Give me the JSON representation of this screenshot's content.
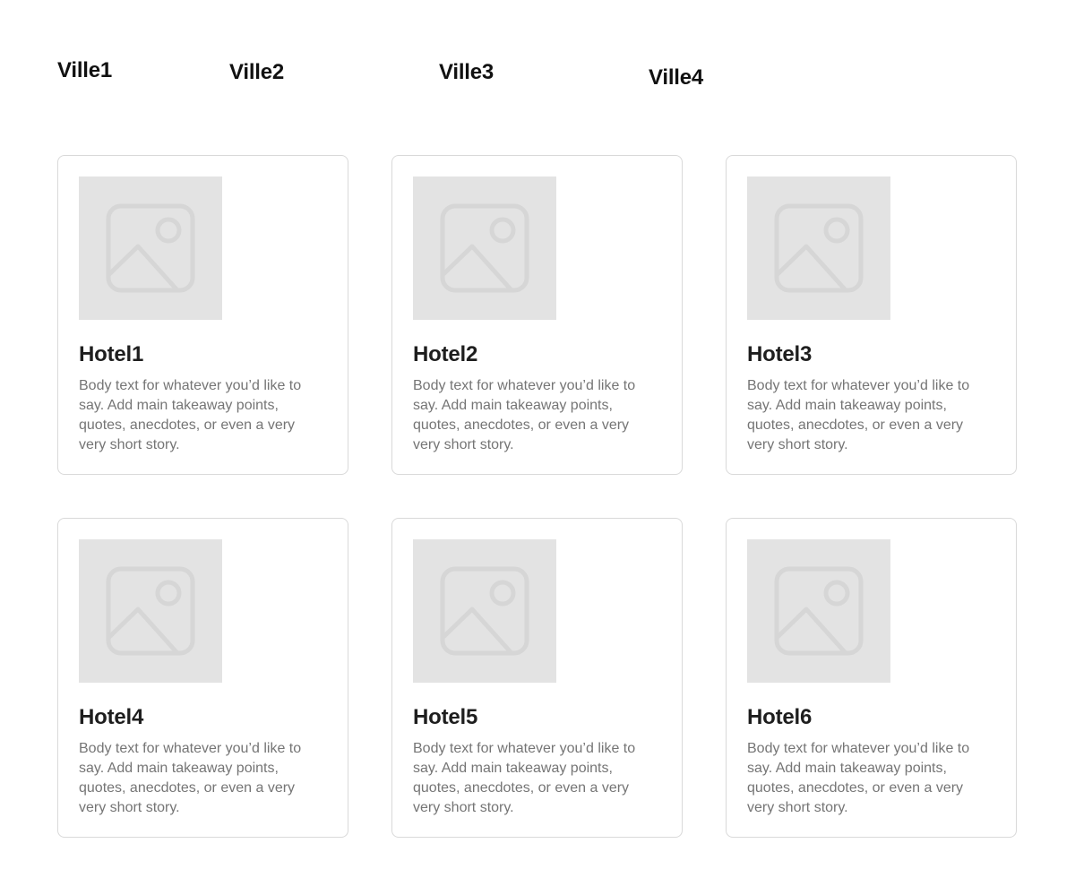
{
  "cities": [
    "Ville1",
    "Ville2",
    "Ville3",
    "Ville4"
  ],
  "hotels": [
    {
      "title": "Hotel1",
      "body": "Body text for whatever you’d like to say. Add main takeaway points, quotes, anecdotes, or even a very very short story."
    },
    {
      "title": "Hotel2",
      "body": "Body text for whatever you’d like to say. Add main takeaway points, quotes, anecdotes, or even a very very short story."
    },
    {
      "title": "Hotel3",
      "body": "Body text for whatever you’d like to say. Add main takeaway points, quotes, anecdotes, or even a very very short story."
    },
    {
      "title": "Hotel4",
      "body": "Body text for whatever you’d like to say. Add main takeaway points, quotes, anecdotes, or even a very very short story."
    },
    {
      "title": "Hotel5",
      "body": "Body text for whatever you’d like to say. Add main takeaway points, quotes, anecdotes, or even a very very short story."
    },
    {
      "title": "Hotel6",
      "body": "Body text for whatever you’d like to say. Add main takeaway points, quotes, anecdotes, or even a very very short story."
    }
  ],
  "image_icon": "image-placeholder-icon",
  "colors": {
    "image_bg": "#e3e3e3",
    "card_border": "#d9d9d9",
    "title_text": "#1e1e1e",
    "body_text": "#757575"
  }
}
